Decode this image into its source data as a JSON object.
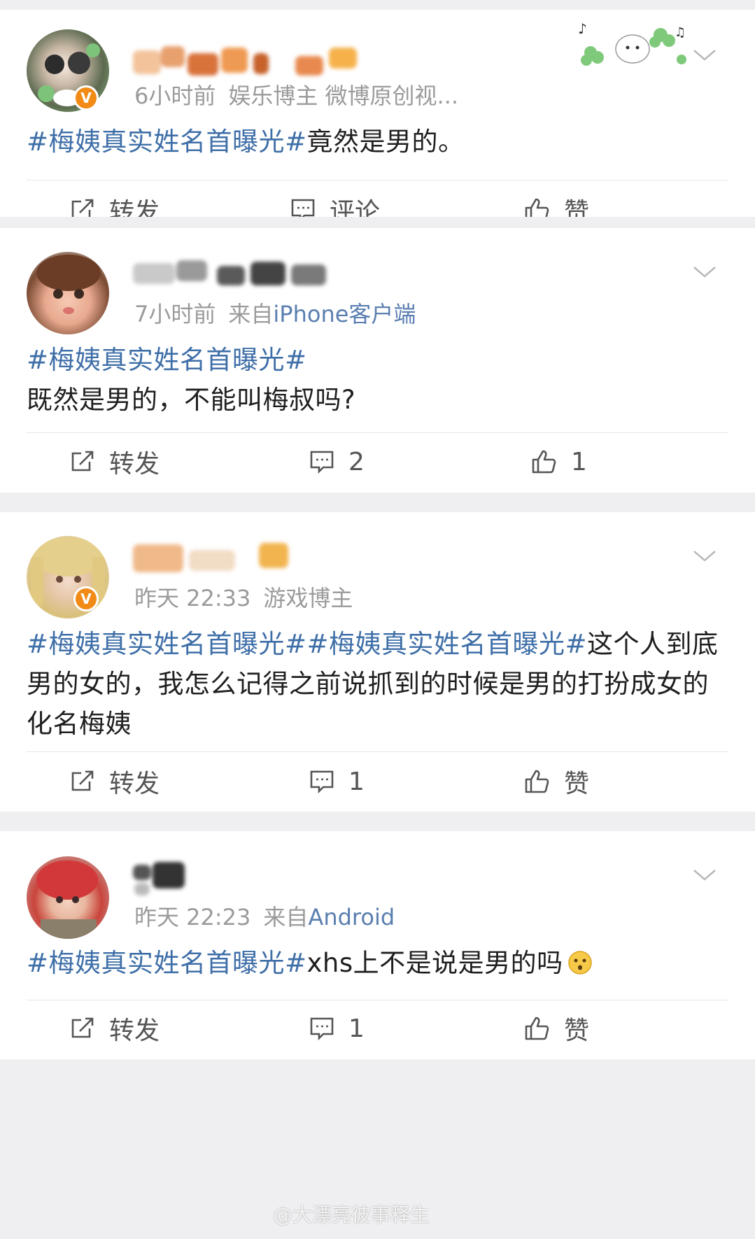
{
  "posts": [
    {
      "time": "6小时前",
      "source": "娱乐博主 微博原创视...",
      "verified": true,
      "topic": "#梅姨真实姓名首曝光#",
      "text": "竟然是男的。",
      "actions": {
        "repost": "转发",
        "comment": "评论",
        "like": "赞"
      }
    },
    {
      "time": "7小时前",
      "source_prefix": "来自",
      "device": "iPhone客户端",
      "verified": false,
      "topic": "#梅姨真实姓名首曝光#",
      "text": "既然是男的，不能叫梅叔吗?",
      "actions": {
        "repost": "转发",
        "comment": "2",
        "like": "1"
      }
    },
    {
      "time": "昨天 22:33",
      "source": "游戏博主",
      "verified": true,
      "topic": "#梅姨真实姓名首曝光##梅姨真实姓名首曝光#",
      "text": "这个人到底男的女的，我怎么记得之前说抓到的时候是男的打扮成女的化名梅姨",
      "actions": {
        "repost": "转发",
        "comment": "1",
        "like": "赞"
      }
    },
    {
      "time": "昨天 22:23",
      "source_prefix": "来自",
      "device": "Android",
      "verified": false,
      "topic": "#梅姨真实姓名首曝光#",
      "text": "xhs上不是说是男的吗",
      "emoji": "thinking-emoji",
      "actions": {
        "repost": "转发",
        "comment": "1",
        "like": "赞"
      }
    }
  ],
  "watermark": "@大漂亮彼事释生",
  "colors": {
    "topic": "#3f6fa8",
    "meta": "#9b9b9b",
    "verified_badge": "#f28a16",
    "background": "#efeff1"
  }
}
